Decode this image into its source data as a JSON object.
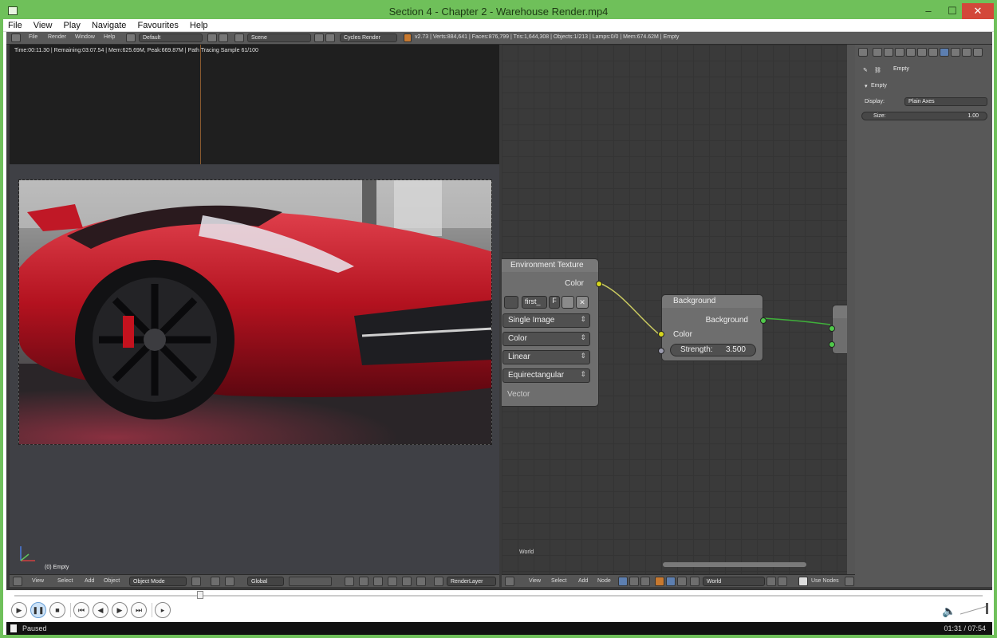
{
  "window": {
    "title": "Section 4 - Chapter 2 - Warehouse Render.mp4",
    "minimize": "–",
    "maximize": "☐",
    "close": "✕"
  },
  "menu": [
    "File",
    "View",
    "Play",
    "Navigate",
    "Favourites",
    "Help"
  ],
  "blender_header": {
    "menus": [
      "File",
      "Render",
      "Window",
      "Help"
    ],
    "layout": "Default",
    "scene": "Scene",
    "engine": "Cycles Render",
    "stats": "v2.73 | Verts:884,641 | Faces:876,799 | Tris:1,644,308 | Objects:1/213 | Lamps:0/0 | Mem:674.62M | Empty"
  },
  "viewport": {
    "status": "Time:00:11.30 | Remaining:03:07.54 | Mem:625.69M, Peak:669.87M | Path Tracing Sample 61/100",
    "object_label": "(0) Empty"
  },
  "left_footer": {
    "menus": [
      "View",
      "Select",
      "Add",
      "Object"
    ],
    "mode": "Object Mode",
    "orientation": "Global",
    "layer": "RenderLayer"
  },
  "nodes": {
    "env_texture": {
      "title": "Environment Texture",
      "output": "Color",
      "image_name": "first_",
      "users": "F",
      "dropdowns": [
        "Single Image",
        "Color",
        "Linear",
        "Equirectangular"
      ],
      "input": "Vector"
    },
    "background": {
      "title": "Background",
      "output": "Background",
      "input_color": "Color",
      "strength_label": "Strength:",
      "strength_value": "3.500"
    },
    "editor_label": "World",
    "socket_colors": {
      "color": "#d6d61e",
      "shader": "#4fc94a",
      "vector": "#9a9aac"
    }
  },
  "node_footer": {
    "menus": [
      "View",
      "Select",
      "Add",
      "Node"
    ],
    "world": "World",
    "use_nodes": "Use Nodes"
  },
  "properties": {
    "object_name": "Empty",
    "panel_title": "Empty",
    "display_label": "Display:",
    "display_value": "Plain Axes",
    "size_label": "Size:",
    "size_value": "1.00"
  },
  "player": {
    "status": "Paused",
    "time": "01:31 / 07:54",
    "progress_fraction": 0.192,
    "buttons": [
      "play",
      "pause",
      "stop",
      "previous",
      "rewind",
      "fast-forward",
      "next",
      "frame-step"
    ]
  }
}
